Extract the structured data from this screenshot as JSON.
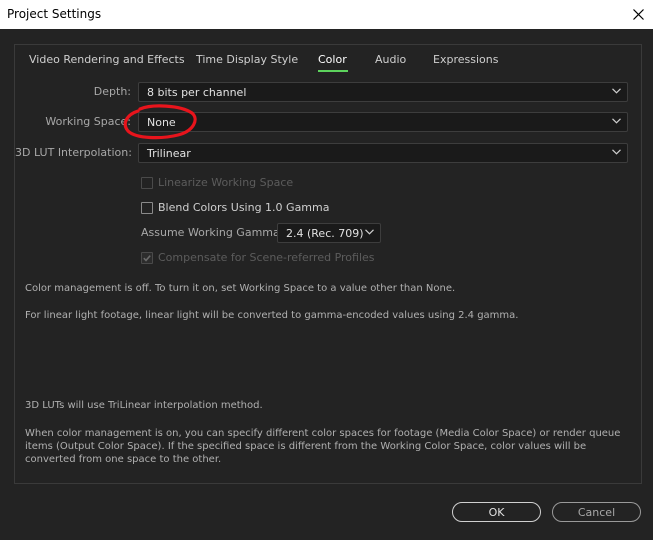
{
  "window": {
    "title": "Project Settings"
  },
  "tabs": [
    {
      "label": "Video Rendering and Effects",
      "active": false
    },
    {
      "label": "Time Display Style",
      "active": false
    },
    {
      "label": "Color",
      "active": true
    },
    {
      "label": "Audio",
      "active": false
    },
    {
      "label": "Expressions",
      "active": false
    }
  ],
  "depth": {
    "label": "Depth:",
    "value": "8 bits per channel"
  },
  "working_space": {
    "label": "Working Space:",
    "value": "None"
  },
  "lut_interpolation": {
    "label": "3D LUT Interpolation:",
    "value": "Trilinear"
  },
  "options": {
    "linearize": {
      "label": "Linearize Working Space",
      "checked": false,
      "enabled": false
    },
    "blend_gamma": {
      "label": "Blend Colors Using 1.0 Gamma",
      "checked": false,
      "enabled": true
    },
    "assume_gamma": {
      "label": "Assume Working Gamma:",
      "value": "2.4 (Rec. 709)"
    },
    "compensate": {
      "label": "Compensate for Scene-referred Profiles",
      "checked": true,
      "enabled": false
    }
  },
  "messages": {
    "management_off": "Color management is off. To turn it on, set Working Space to a value other than None.",
    "linear_light": "For linear light footage, linear light will be converted to gamma-encoded values using 2.4 gamma.",
    "lut_info": "3D LUTs will use TriLinear interpolation method.",
    "color_management_info": "When color management is on, you can specify different color spaces for footage (Media Color Space) or render queue items (Output Color Space). If the specified space is different from the Working Color Space, color values will be converted from one space to the other."
  },
  "buttons": {
    "ok": "OK",
    "cancel": "Cancel"
  },
  "colors": {
    "active_tab_underline": "#5dd35d",
    "annotation": "#e8141c",
    "background": "#232323"
  },
  "icons": {
    "close": "close-icon",
    "dropdown": "chevron-down-icon",
    "checkmark": "checkmark-icon"
  }
}
